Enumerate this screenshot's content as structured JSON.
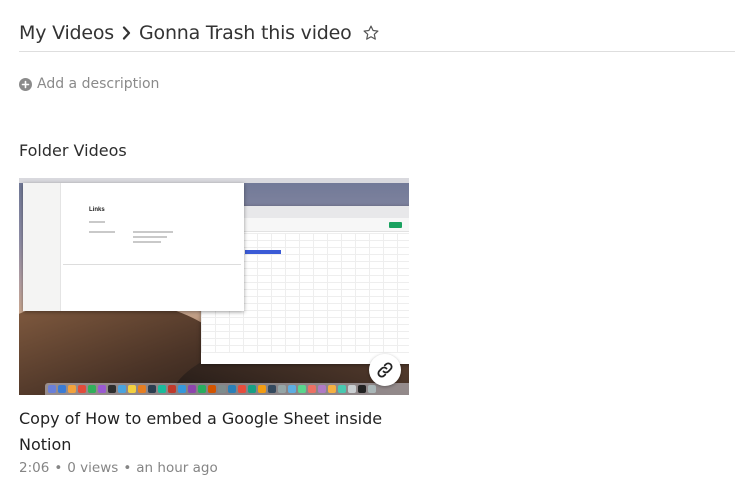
{
  "breadcrumb": {
    "parent": "My Videos",
    "current": "Gonna Trash this video"
  },
  "description": {
    "add_label": "Add a description"
  },
  "section": {
    "title": "Folder Videos"
  },
  "video": {
    "title": "Copy of How to embed a Google Sheet inside Notion",
    "duration": "2:06",
    "views": "0 views",
    "time_ago": "an hour ago",
    "thumbnail_heading": "Links",
    "icons": {
      "copy_link": "link-icon",
      "star": "star-outline-icon",
      "chevron": "chevron-right-icon",
      "add": "plus-circle-icon"
    }
  },
  "colors": {
    "text": "#2d2d2d",
    "muted": "#858585",
    "divider": "#dedede"
  }
}
